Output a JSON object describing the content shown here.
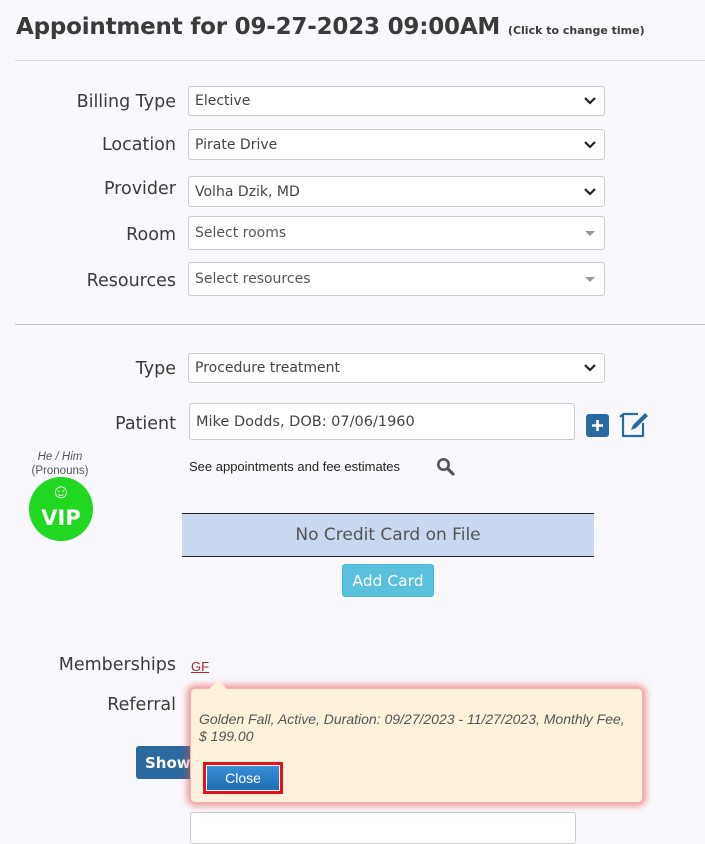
{
  "header": {
    "title": "Appointment for 09-27-2023 09:00AM",
    "hint": "(Click to change time)"
  },
  "form": {
    "billing_type": {
      "label": "Billing Type",
      "value": "Elective"
    },
    "location": {
      "label": "Location",
      "value": "Pirate Drive"
    },
    "provider": {
      "label": "Provider",
      "value": "Volha Dzik, MD"
    },
    "room": {
      "label": "Room",
      "placeholder": "Select rooms"
    },
    "resources": {
      "label": "Resources",
      "placeholder": "Select resources"
    },
    "type": {
      "label": "Type",
      "value": "Procedure treatment"
    },
    "patient": {
      "label": "Patient",
      "value": "Mike Dodds, DOB: 07/06/1960",
      "add_icon": "plus-icon",
      "edit_icon": "edit-note-icon"
    },
    "see_appointments": "See appointments and fee estimates",
    "memberships": {
      "label": "Memberships",
      "link": "GF"
    },
    "referral": {
      "label": "Referral"
    }
  },
  "patient_badge": {
    "pronouns": "He / Him",
    "pronouns_caption": "(Pronouns)",
    "vip_text": "VIP",
    "vip_face": "☺"
  },
  "credit_card": {
    "message": "No Credit Card on File",
    "add_label": "Add Card"
  },
  "buttons": {
    "show_label": "Show"
  },
  "popover": {
    "text": "Golden Fall, Active, Duration: 09/27/2023 - 11/27/2023, Monthly Fee, $ 199.00",
    "close_label": "Close"
  },
  "colors": {
    "primary": "#2a6aa0",
    "info": "#5bc0de",
    "vip_green": "#1fd81f",
    "highlight_red": "#e8111a",
    "card_bg": "#c9d7ef",
    "popover_bg": "#fdf1dc"
  }
}
